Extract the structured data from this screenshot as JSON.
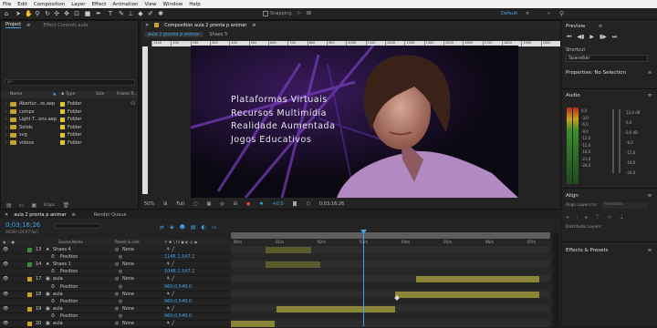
{
  "menu": [
    "File",
    "Edit",
    "Composition",
    "Layer",
    "Effect",
    "Animation",
    "View",
    "Window",
    "Help"
  ],
  "toolbar": {
    "snapping": "Snapping",
    "workspace_default": "Default",
    "workspace_menu": "≡",
    "overflow": "»"
  },
  "project": {
    "tab": "Project",
    "menu": "≡",
    "effects_tab": "Effect Controls aula",
    "search_placeholder": "ρ•",
    "columns": {
      "name": "Name",
      "type": "Type",
      "size": "Size",
      "frame": "Frame R..."
    },
    "items": [
      {
        "name": "Abertur...re.aep",
        "type": "Folder"
      },
      {
        "name": "comps",
        "type": "Folder"
      },
      {
        "name": "Light T...ons.aep",
        "type": "Folder"
      },
      {
        "name": "Solids",
        "type": "Folder"
      },
      {
        "name": "svg",
        "type": "Folder"
      },
      {
        "name": "videos",
        "type": "Folder"
      }
    ],
    "bpc": "8 bpc"
  },
  "composition": {
    "tab": "Composition aula 2 pronta p animar",
    "menu": "≡",
    "subtabs": [
      "aula 2 pronta p animar",
      "Shaes 5"
    ],
    "ruler": [
      "1100",
      "100",
      "200",
      "300",
      "400",
      "500",
      "600",
      "700",
      "800",
      "900",
      "1000",
      "1100",
      "1200",
      "1300",
      "1400",
      "1500",
      "1600",
      "1700",
      "1800",
      "1900",
      "2000"
    ],
    "overlay": [
      "Plataformas Virtuais",
      "Recursos Multimídia",
      "Realidade Aumentada",
      "Jogos Educativos"
    ],
    "zoom": "50%",
    "resolution": "Full",
    "exposure": "+0,0",
    "timecode": "0;03;16;26"
  },
  "preview": {
    "title": "Preview",
    "menu": "≡",
    "shortcut_label": "Shortcut",
    "shortcut_value": "Spacebar"
  },
  "properties": {
    "title": "Properties: No Selection",
    "menu": "≡"
  },
  "audio": {
    "title": "Audio",
    "menu": "≡",
    "left_scale": [
      "0,0",
      "-3,0",
      "-6,0",
      "-9,0",
      "-12,0",
      "-15,0",
      "-18,0",
      "-21,0",
      "-24,0"
    ],
    "right_scale": [
      "12,0 dB",
      "6,0",
      "0,0 dB",
      "-6,0",
      "-12,0",
      "-18,0",
      "-24,0"
    ]
  },
  "align": {
    "title": "Align",
    "menu": "≡",
    "align_layers_to": "Align Layers to:",
    "align_target": "Selection",
    "distribute": "Distribute Layers:"
  },
  "effects": {
    "title": "Effects & Presets",
    "menu": "≡"
  },
  "timeline": {
    "tab": "aula 2 pronta p animar",
    "menu": "≡",
    "render_queue": "Render Queue",
    "timecode": "0;03;16;26",
    "fps": "00000 (29,97 fps)",
    "col_source": "Source Name",
    "col_parent": "Parent & Link",
    "ruler": [
      "00m",
      "01m",
      "02m",
      "03m",
      "04m",
      "05m",
      "06m",
      "07m"
    ],
    "layers": [
      {
        "num": "13",
        "name": "Shaes 4",
        "parent": "None",
        "kind": "layer"
      },
      {
        "num": "",
        "name": "Position",
        "value": "1145,1,547,1",
        "kind": "prop"
      },
      {
        "num": "14",
        "name": "Shaes 1",
        "parent": "None",
        "kind": "layer"
      },
      {
        "num": "",
        "name": "Position",
        "value": "1046,1,547,1",
        "kind": "prop"
      },
      {
        "num": "17",
        "name": "aula",
        "parent": "None",
        "kind": "layer"
      },
      {
        "num": "",
        "name": "Position",
        "value": "960,0,540,0",
        "kind": "prop"
      },
      {
        "num": "18",
        "name": "aula",
        "parent": "None",
        "kind": "layer"
      },
      {
        "num": "",
        "name": "Position",
        "value": "960,0,540,0",
        "kind": "prop"
      },
      {
        "num": "19",
        "name": "aula",
        "parent": "None",
        "kind": "layer"
      },
      {
        "num": "",
        "name": "Position",
        "value": "960,0,540,0",
        "kind": "prop"
      },
      {
        "num": "20",
        "name": "aula",
        "parent": "None",
        "kind": "layer"
      }
    ]
  }
}
